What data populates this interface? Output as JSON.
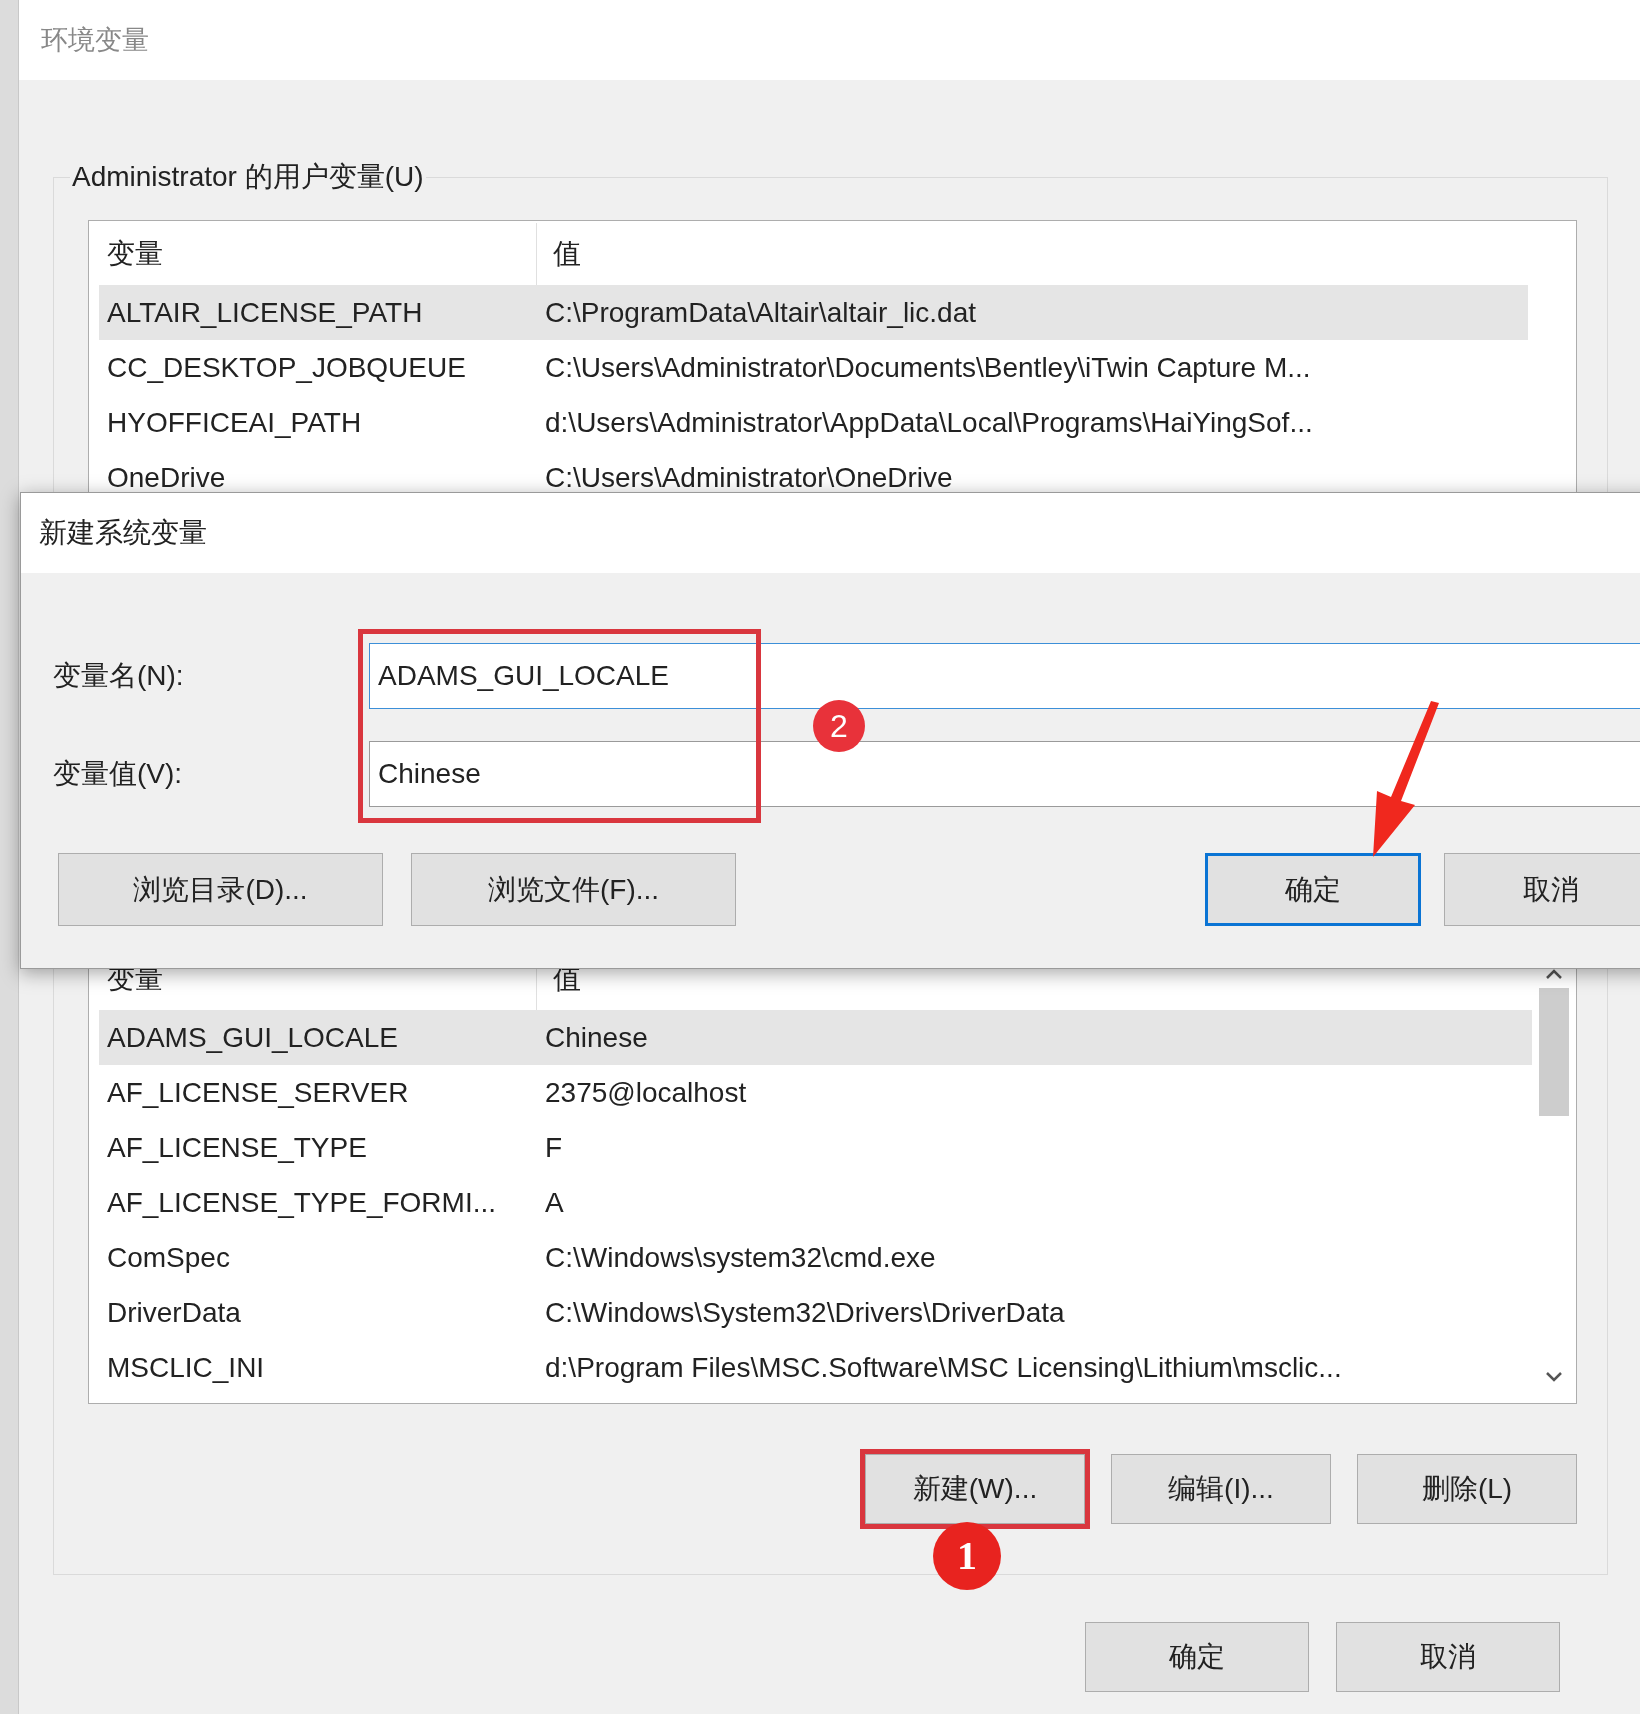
{
  "window": {
    "title": "环境变量"
  },
  "user_variables": {
    "label": "Administrator 的用户变量(U)",
    "columns": [
      "变量",
      "值"
    ],
    "rows": [
      {
        "name": "ALTAIR_LICENSE_PATH",
        "value": "C:\\ProgramData\\Altair\\altair_lic.dat",
        "selected": true
      },
      {
        "name": "CC_DESKTOP_JOBQUEUE",
        "value": "C:\\Users\\Administrator\\Documents\\Bentley\\iTwin Capture M...",
        "selected": false
      },
      {
        "name": "HYOFFICEAI_PATH",
        "value": "d:\\Users\\Administrator\\AppData\\Local\\Programs\\HaiYingSof...",
        "selected": false
      },
      {
        "name": "OneDrive",
        "value": "C:\\Users\\Administrator\\OneDrive",
        "selected": false
      }
    ]
  },
  "dialog": {
    "title": "新建系统变量",
    "fields_highlighted": true,
    "badge": "2",
    "fields": [
      {
        "label": "变量名(N):",
        "value": "ADAMS_GUI_LOCALE"
      },
      {
        "label": "变量值(V):",
        "value": "Chinese"
      }
    ],
    "buttons": [
      {
        "label": "浏览目录(D)...",
        "focused": false
      },
      {
        "label": "浏览文件(F)...",
        "focused": false
      },
      {
        "label": "确定",
        "focused": true
      },
      {
        "label": "取消",
        "focused": false
      }
    ]
  },
  "system_variables": {
    "columns": [
      "变量",
      "值"
    ],
    "rows": [
      {
        "name": "ADAMS_GUI_LOCALE",
        "value": "Chinese",
        "selected": true
      },
      {
        "name": "AF_LICENSE_SERVER",
        "value": "2375@localhost",
        "selected": false
      },
      {
        "name": "AF_LICENSE_TYPE",
        "value": "F",
        "selected": false
      },
      {
        "name": "AF_LICENSE_TYPE_FORMI...",
        "value": "A",
        "selected": false
      },
      {
        "name": "ComSpec",
        "value": "C:\\Windows\\system32\\cmd.exe",
        "selected": false
      },
      {
        "name": "DriverData",
        "value": "C:\\Windows\\System32\\Drivers\\DriverData",
        "selected": false
      },
      {
        "name": "MSCLIC_INI",
        "value": "d:\\Program Files\\MSC.Software\\MSC Licensing\\Lithium\\msclic...",
        "selected": false
      }
    ],
    "badge": "1",
    "buttons": [
      {
        "label": "新建(W)...",
        "highlighted": true
      },
      {
        "label": "编辑(I)...",
        "highlighted": false
      },
      {
        "label": "删除(L)",
        "highlighted": false
      }
    ]
  },
  "buttons": [
    "确定",
    "取消"
  ]
}
